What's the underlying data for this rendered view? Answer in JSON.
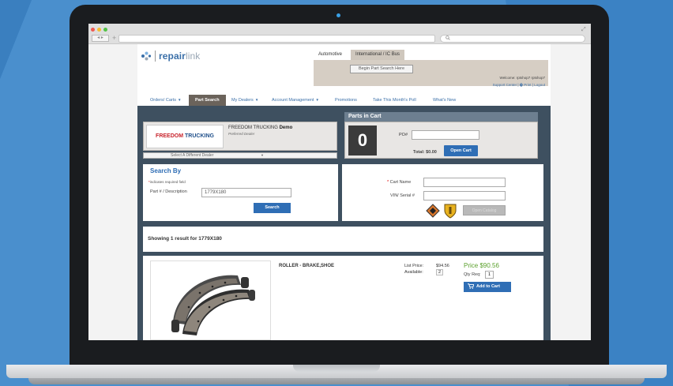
{
  "browser": {
    "nav_buttons": "◂ ▸",
    "new_tab": "+",
    "search_icon": "search-icon"
  },
  "app": {
    "brand_prefix": "repair",
    "brand_suffix": "link",
    "brand_color": "#3a6fa8",
    "accent_color": "#2f6eb5"
  },
  "top_tabs": [
    "Automotive",
    "International / IC Bus"
  ],
  "header": {
    "begin_search_label": "Begin Part Search Here",
    "welcome_text": "Welcome: rptshop7 rptshop7",
    "support_link": "Support Center",
    "print_link": "Print",
    "logout_link": "Logout"
  },
  "menu": {
    "orders_carts": "Orders/ Carts",
    "part_search": "Part Search",
    "my_dealers": "My Dealers",
    "account_management": "Account Management",
    "promotions": "Promotions",
    "poll": "Take This Month's Poll",
    "whats_new": "What's New"
  },
  "dealer": {
    "logo_word1": "FREEDOM",
    "logo_word2": "TRUCKING",
    "name": "FREEDOM TRUCKING",
    "name_suffix": "Demo",
    "status": "Preferred Dealer",
    "select_label": "Select A Different Dealer"
  },
  "cart": {
    "title": "Parts in Cart",
    "count": "0",
    "po_label": "PO#",
    "total_label": "Total:",
    "total_value": "$0.00",
    "open_cart_label": "Open Cart"
  },
  "search": {
    "title": "Search By",
    "required_note": "indicates required field",
    "part_label": "Part # / Description",
    "part_value": "1779X180",
    "search_button": "Search"
  },
  "vin": {
    "cart_name_label": "Cart Name",
    "vin_label": "VIN/ Serial #",
    "open_catalog_label": "Open Catalog",
    "brand_icon1": "international-diamond-icon",
    "brand_icon2": "ic-bus-shield-icon"
  },
  "results": {
    "summary": "Showing 1 result for 1779X180"
  },
  "product": {
    "image_icon": "brake-shoe-image",
    "name": "ROLLER - BRAKE,SHOE",
    "list_price_label": "List Price:",
    "list_price_value": "$94.56",
    "available_label": "Available:",
    "available_value": "2",
    "price": "Price $90.56",
    "price_color": "#5aa02c",
    "qty_label": "Qty Req:",
    "qty_value": "1",
    "add_to_cart_label": "Add to Cart"
  }
}
